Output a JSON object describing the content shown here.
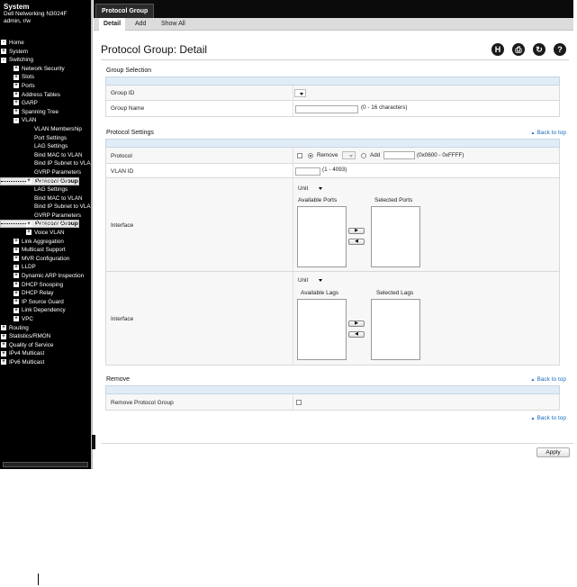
{
  "left_panel": {
    "system_title": "System",
    "device_name": "Dell Networking N3024F",
    "user": "admin, r/w",
    "tree": [
      {
        "label": "Home",
        "depth": 0,
        "box": "-"
      },
      {
        "label": "System",
        "depth": 0,
        "box": "+"
      },
      {
        "label": "Switching",
        "depth": 0,
        "box": "-"
      },
      {
        "label": "Network Security",
        "depth": 1,
        "box": "+"
      },
      {
        "label": "Slots",
        "depth": 1,
        "box": "+"
      },
      {
        "label": "Ports",
        "depth": 1,
        "box": "+"
      },
      {
        "label": "Address Tables",
        "depth": 1,
        "box": "+"
      },
      {
        "label": "GARP",
        "depth": 1,
        "box": "+"
      },
      {
        "label": "Spanning Tree",
        "depth": 1,
        "box": "+"
      },
      {
        "label": "VLAN",
        "depth": 1,
        "box": "-"
      },
      {
        "label": "VLAN Membership",
        "depth": 2,
        "box": ""
      },
      {
        "label": "Port Settings",
        "depth": 2,
        "box": ""
      },
      {
        "label": "LAG Settings",
        "depth": 2,
        "box": ""
      },
      {
        "label": "Bind MAC to VLAN",
        "depth": 2,
        "box": ""
      },
      {
        "label": "Bind IP Subnet to VLAN",
        "depth": 2,
        "box": ""
      },
      {
        "label": "GVRP Parameters",
        "depth": 2,
        "box": ""
      },
      {
        "label": "Protocol Group",
        "depth": 2,
        "box": "",
        "selected": true
      },
      {
        "label": "Double VLAN",
        "depth": 2,
        "box": "+"
      },
      {
        "label": "LAG Settings",
        "depth": 2,
        "box": ""
      },
      {
        "label": "Bind MAC to VLAN",
        "depth": 2,
        "box": ""
      },
      {
        "label": "Bind IP Subnet to VLAN",
        "depth": 2,
        "box": ""
      },
      {
        "label": "GVRP Parameters",
        "depth": 2,
        "box": ""
      },
      {
        "label": "Protocol Group",
        "depth": 2,
        "box": "",
        "selected": true
      },
      {
        "label": "Double VLAN",
        "depth": 2,
        "box": "+"
      },
      {
        "label": "Voice VLAN",
        "depth": 2,
        "box": "+"
      },
      {
        "label": "Link Aggregation",
        "depth": 1,
        "box": "+"
      },
      {
        "label": "Multicast Support",
        "depth": 1,
        "box": "+"
      },
      {
        "label": "MVR Configuration",
        "depth": 1,
        "box": "+"
      },
      {
        "label": "LLDP",
        "depth": 1,
        "box": "+"
      },
      {
        "label": "Dynamic ARP Inspection",
        "depth": 1,
        "box": "+"
      },
      {
        "label": "DHCP Snooping",
        "depth": 1,
        "box": "+"
      },
      {
        "label": "DHCP Relay",
        "depth": 1,
        "box": "+"
      },
      {
        "label": "IP Source Guard",
        "depth": 1,
        "box": "+"
      },
      {
        "label": "Link Dependency",
        "depth": 1,
        "box": "+"
      },
      {
        "label": "VPC",
        "depth": 1,
        "box": "+"
      },
      {
        "label": "Routing",
        "depth": 0,
        "box": "+"
      },
      {
        "label": "Statistics/RMON",
        "depth": 0,
        "box": "+"
      },
      {
        "label": "Quality of Service",
        "depth": 0,
        "box": "+"
      },
      {
        "label": "IPv4 Multicast",
        "depth": 0,
        "box": "+"
      },
      {
        "label": "IPv6 Multicast",
        "depth": 0,
        "box": "+"
      }
    ]
  },
  "tabs": {
    "main": "Protocol Group",
    "sub": [
      "Detail",
      "Add",
      "Show All"
    ]
  },
  "page": {
    "title": "Protocol Group: Detail",
    "toolbar_icons": [
      "save-icon",
      "print-icon",
      "refresh-icon",
      "help-icon"
    ]
  },
  "group_selection": {
    "title": "Group Selection",
    "group_id_label": "Group ID",
    "group_id_value": "",
    "group_name_label": "Group Name",
    "group_name_value": "",
    "group_name_hint": "(0 - 16 characters)"
  },
  "protocol_settings": {
    "title": "Protocol Settings",
    "back_to_top": "Back to top",
    "protocol_label": "Protocol",
    "remove_label": "Remove",
    "add_label": "Add",
    "add_hint": "(0x0600 - 0xFFFF)",
    "vlan_label": "VLAN ID",
    "vlan_hint": "(1 - 4093)",
    "interface_label": "Interface",
    "unit_label": "Unit",
    "available_ports": "Available Ports",
    "selected_ports": "Selected Ports",
    "available_lags": "Available Lags",
    "selected_lags": "Selected Lags"
  },
  "remove_section": {
    "title": "Remove",
    "back_to_top": "Back to top",
    "remove_group_label": "Remove Protocol Group"
  },
  "bottom_back_to_top": "Back to top",
  "apply_label": "Apply"
}
